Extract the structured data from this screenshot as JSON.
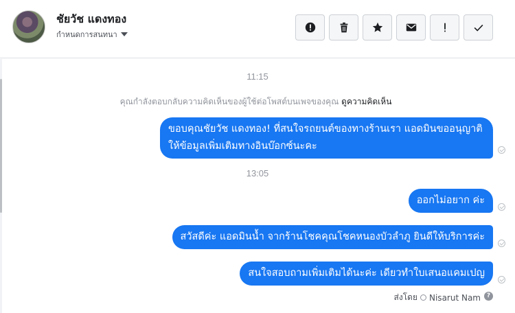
{
  "header": {
    "contact_name": "ชัยวัช แดงทอง",
    "assign_label": "กำหนดการสนทนา",
    "actions": [
      {
        "icon": "alert-circle-icon"
      },
      {
        "icon": "trash-icon"
      },
      {
        "icon": "star-icon"
      },
      {
        "icon": "mail-icon"
      },
      {
        "icon": "exclamation-icon",
        "text": "!"
      },
      {
        "icon": "checkmark-icon"
      }
    ]
  },
  "conversation": {
    "timestamp_1": "11:15",
    "system_message": "คุณกำลังตอบกลับความคิดเห็นของผู้ใช้ต่อโพสต์บนเพจของคุณ",
    "system_link": "ดูความคิดเห็น",
    "message_1": "ขอบคุณชัยวัช แดงทอง! ที่สนใจรถยนต์ของทางร้านเรา แอดมินขออนุญาติ ให้ข้อมูลเพิ่มเติมทางอินบ๊อกซ์นะคะ",
    "timestamp_2": "13:05",
    "message_2": "ออกไม่อยาก ค่ะ",
    "message_3": "สวัสดีค่ะ แอดมินน้ำ จากร้านโชคคุณโชคหนองบัวลำภู ยินดีให้บริการค่ะ",
    "message_4": "สนใจสอบถามเพิ่มเติมได้นะค่ะ เดียวทำใบเสนอแคมเปญ",
    "sent_by_label": "ส่งโดย",
    "sent_by_name": "Nisarut Nam"
  },
  "colors": {
    "bubble": "#1877f2",
    "muted_text": "#90949c"
  }
}
